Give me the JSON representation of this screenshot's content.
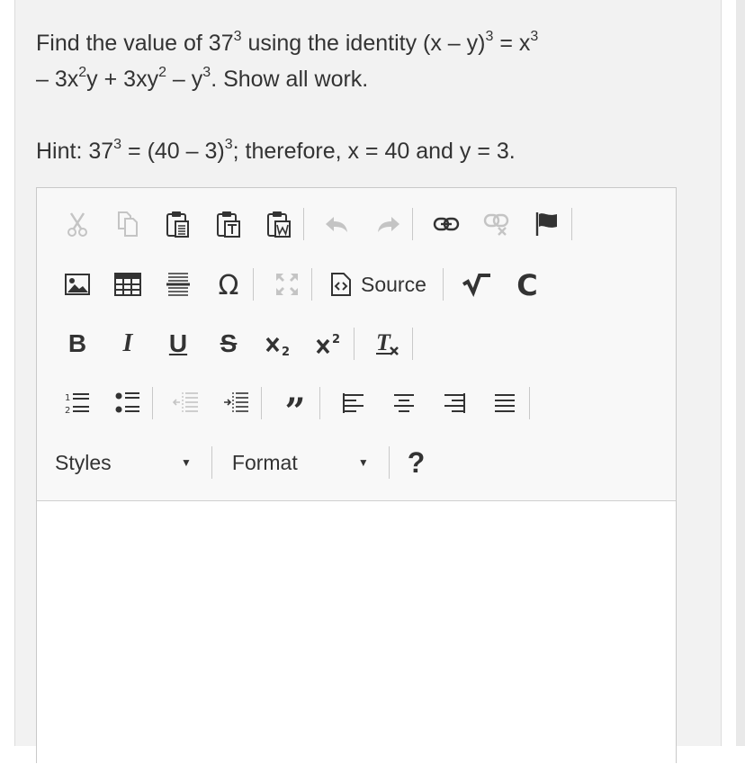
{
  "question": {
    "line1_prefix": "Find the value of 37",
    "line1_sup1": "3",
    "line1_mid": " using the identity (x – y)",
    "line1_sup2": "3",
    "line1_eq": " = x",
    "line1_sup3": "3",
    "line2_a": "– 3x",
    "line2_sup1": "2",
    "line2_b": "y + 3xy",
    "line2_sup2": "2",
    "line2_c": " – y",
    "line2_sup3": "3",
    "line2_d": ". Show all work."
  },
  "hint": {
    "prefix": "Hint: 37",
    "sup1": "3",
    "mid": " = (40 – 3)",
    "sup2": "3",
    "suffix": "; therefore, x = 40 and y = 3."
  },
  "toolbar": {
    "source_label": "Source",
    "bold_label": "B",
    "italic_label": "I",
    "underline_label": "U",
    "strike_label": "S",
    "styles_label": "Styles",
    "format_label": "Format",
    "help_label": "?",
    "dropdown_arrow": "▼"
  },
  "editor": {
    "content": ""
  }
}
